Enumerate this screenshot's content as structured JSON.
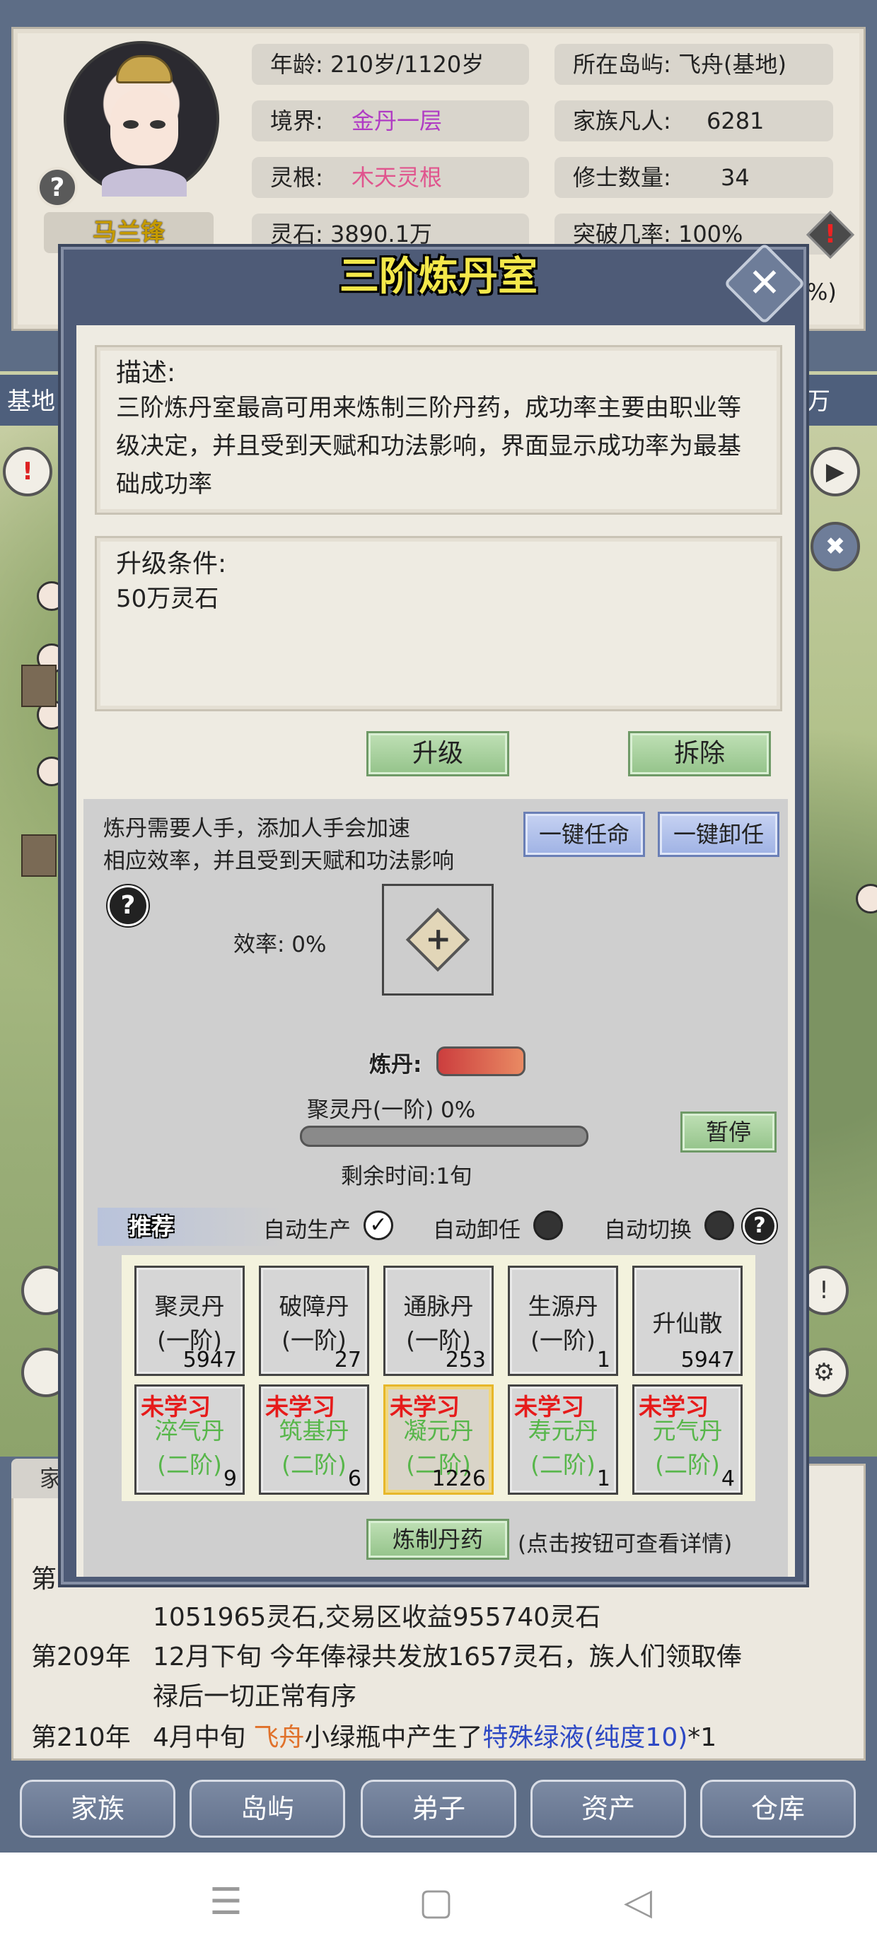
{
  "character": {
    "name": "马兰锋",
    "help": "?",
    "age": "年龄: 210岁/1120岁",
    "realm_label": "境界:",
    "realm_value": "金丹一层",
    "root_label": "灵根:",
    "root_value": "木天灵根",
    "spirit_stones": "灵石: 3890.1万",
    "island": "所在岛屿: 飞舟(基地)",
    "family_mortals_label": "家族凡人:",
    "family_mortals_value": "6281",
    "cultivators_label": "修士数量:",
    "cultivators_value": "34",
    "breakthrough": "突破几率: 100%",
    "breakthrough_extra": "%)",
    "warn": "!"
  },
  "map": {
    "bar_left": "基地",
    "bar_right": "万",
    "play_icon": "▶",
    "tool_icon": "✖",
    "alert_icon": "!",
    "gear_icon": "⚙"
  },
  "modal": {
    "title": "三阶炼丹室",
    "close": "✕",
    "description_title": "描述:",
    "description_text": "三阶炼丹室最高可用来炼制三阶丹药，成功率主要由职业等级决定，并且受到天赋和功法影响，界面显示成功率为最基础成功率",
    "upgrade_title": "升级条件:",
    "upgrade_text": "50万灵石",
    "upgrade_button": "升级",
    "demolish_button": "拆除",
    "staff_note_line1": "炼丹需要人手，添加人手会加速",
    "staff_note_line2": "相应效率，并且受到天赋和功法影响",
    "appoint_all": "一键任命",
    "dismiss_all": "一键卸任",
    "help": "?",
    "efficiency": "效率: 0%",
    "add_slot": "+",
    "alchemy_label": "炼丹:",
    "current_pill": "聚灵丹(一阶) 0%",
    "progress": 0,
    "remaining": "剩余时间:1旬",
    "pause": "暂停",
    "recommend": "推荐",
    "auto_produce": "自动生产",
    "auto_produce_check": "✓",
    "auto_dismiss": "自动卸任",
    "auto_switch": "自动切换",
    "refine_button": "炼制丹药",
    "refine_note": "(点击按钮可查看详情)"
  },
  "pills_row1": [
    {
      "name": "聚灵丹",
      "tier": "(一阶)",
      "count": "5947"
    },
    {
      "name": "破障丹",
      "tier": "(一阶)",
      "count": "27"
    },
    {
      "name": "通脉丹",
      "tier": "(一阶)",
      "count": "253"
    },
    {
      "name": "生源丹",
      "tier": "(一阶)",
      "count": "1"
    },
    {
      "name": "升仙散",
      "tier": "",
      "count": "5947"
    }
  ],
  "pills_row2": [
    {
      "status": "未学习",
      "name": "淬气丹",
      "tier": "(二阶)",
      "count": "9"
    },
    {
      "status": "未学习",
      "name": "筑基丹",
      "tier": "(二阶)",
      "count": "6"
    },
    {
      "status": "未学习",
      "name": "凝元丹",
      "tier": "(二阶)",
      "count": "1226"
    },
    {
      "status": "未学习",
      "name": "寿元丹",
      "tier": "(二阶)",
      "count": "1"
    },
    {
      "status": "未学习",
      "name": "元气丹",
      "tier": "(二阶)",
      "count": "4"
    }
  ],
  "log": {
    "tab": "家",
    "partial_year": "第",
    "line1_text": "1051965灵石,交易区收益955740灵石",
    "line2_year": "第209年",
    "line2_text": "12月下旬 今年俸禄共发放1657灵石，族人们领取俸",
    "line3_text": "禄后一切正常有序",
    "line4_year": "第210年",
    "line4_prefix": "4月中旬 ",
    "line4_place": "飞舟",
    "line4_mid": "小绿瓶中产生了",
    "line4_item": "特殊绿液(纯度10)",
    "line4_suffix": "*1"
  },
  "bottom_nav": [
    "家族",
    "岛屿",
    "弟子",
    "资产",
    "仓库"
  ],
  "system_nav": {
    "menu": "☰",
    "home": "▢",
    "back": "◁"
  }
}
